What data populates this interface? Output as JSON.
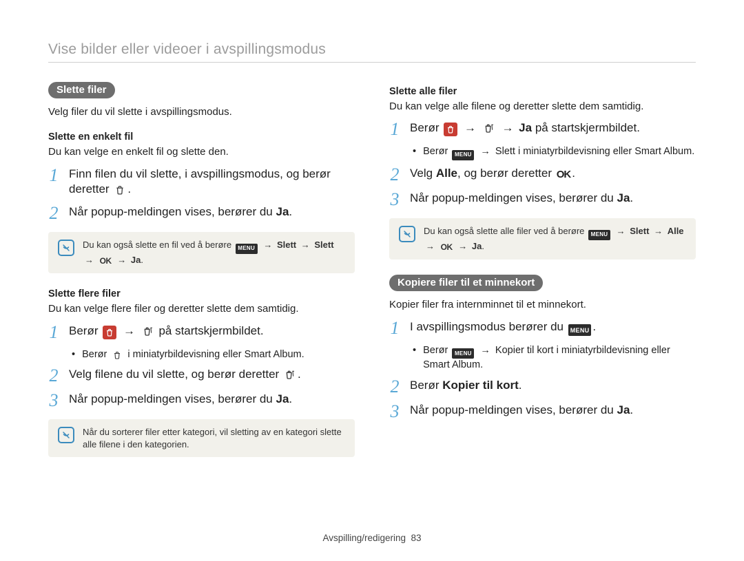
{
  "breadcrumb": "Vise bilder eller videoer i avspillingsmodus",
  "icons": {
    "menu_label": "MENU",
    "ok_label": "OK"
  },
  "left": {
    "chip": "Slette filer",
    "intro": "Velg filer du vil slette i avspillingsmodus.",
    "single": {
      "title": "Slette en enkelt fil",
      "desc": "Du kan velge en enkelt fil og slette den.",
      "step1_a": "Finn filen du vil slette, i avspillingsmodus, og berør deretter ",
      "step1_b": ".",
      "step2_a": "Når popup-meldingen vises, berører du ",
      "step2_b": "Ja",
      "step2_c": ".",
      "note_a": "Du kan også slette en fil ved å berøre ",
      "note_slett": "Slett",
      "note_ja": "Ja",
      "arrow": "→"
    },
    "multi": {
      "title": "Slette flere filer",
      "desc": "Du kan velge flere filer og deretter slette dem samtidig.",
      "step1_a": "Berør ",
      "step1_b": " på startskjermbildet.",
      "bullet_a": "Berør ",
      "bullet_b": " i miniatyrbildevisning eller Smart Album.",
      "step2_a": "Velg filene du vil slette, og berør deretter ",
      "step2_b": ".",
      "step3_a": "Når popup-meldingen vises, berører du ",
      "step3_b": "Ja",
      "step3_c": ".",
      "note": "Når du sorterer filer etter kategori, vil sletting av en kategori slette alle filene i den kategorien.",
      "arrow": "→"
    }
  },
  "right": {
    "all": {
      "title": "Slette alle filer",
      "desc": "Du kan velge alle filene og deretter slette dem samtidig.",
      "step1_a": "Berør ",
      "step1_ja": "Ja",
      "step1_b": " på startskjermbildet.",
      "bullet_a": "Berør ",
      "bullet_slett": "Slett",
      "bullet_b": " i miniatyrbildevisning eller Smart Album.",
      "step2_a": "Velg ",
      "step2_alle": "Alle",
      "step2_b": ", og berør deretter ",
      "step2_c": ".",
      "step3_a": "Når popup-meldingen vises, berører du ",
      "step3_b": "Ja",
      "step3_c": ".",
      "note_a": "Du kan også slette alle filer ved å berøre ",
      "note_slett": "Slett",
      "note_alle": "Alle",
      "note_ja": "Ja",
      "arrow": "→"
    },
    "copy": {
      "chip": "Kopiere filer til et minnekort",
      "desc": "Kopier filer fra internminnet til et minnekort.",
      "step1_a": "I avspillingsmodus berører du ",
      "step1_b": ".",
      "bullet_a": "Berør ",
      "bullet_kopier": "Kopier til kort",
      "bullet_b": " i miniatyrbildevisning eller Smart Album.",
      "step2_a": "Berør ",
      "step2_b": "Kopier til kort",
      "step2_c": ".",
      "step3_a": "Når popup-meldingen vises, berører du ",
      "step3_b": "Ja",
      "step3_c": ".",
      "arrow": "→"
    }
  },
  "footer": {
    "section": "Avspilling/redigering",
    "page": "83"
  }
}
